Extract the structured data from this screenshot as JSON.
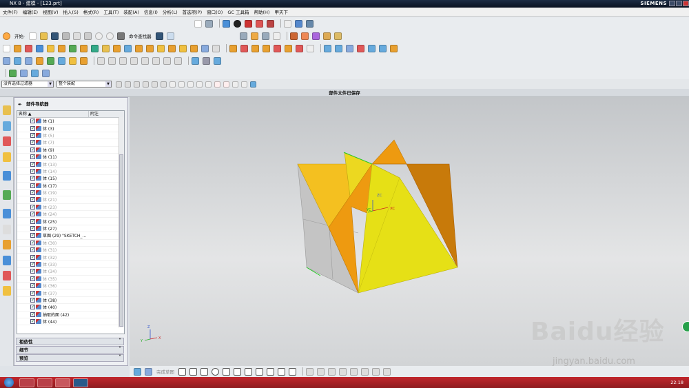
{
  "window": {
    "title": "NX 8 - 建模 - [123.prt]",
    "brand": "SIEMENS"
  },
  "menu": [
    "文件(F)",
    "编辑(E)",
    "视图(V)",
    "插入(S)",
    "格式(R)",
    "工具(T)",
    "装配(A)",
    "信息(I)",
    "分析(L)",
    "首选项(P)",
    "窗口(O)",
    "GC 工具箱",
    "帮助(H)",
    "甲天下"
  ],
  "toolbar": {
    "start_label": "开始·",
    "command_finder_label": "命令查找器"
  },
  "filters": {
    "selection_filter": "没有选择过滤器",
    "assembly_scope": "整个装配"
  },
  "status": {
    "message": "部件文件已保存"
  },
  "navigator": {
    "title": "部件导航器",
    "col_name": "名称",
    "col_note": "附注",
    "rows": [
      {
        "label": "体 (1)",
        "dim": false
      },
      {
        "label": "体 (3)",
        "dim": false
      },
      {
        "label": "体 (5)",
        "dim": true
      },
      {
        "label": "体 (7)",
        "dim": true
      },
      {
        "label": "体 (9)",
        "dim": false
      },
      {
        "label": "体 (11)",
        "dim": false
      },
      {
        "label": "体 (13)",
        "dim": true
      },
      {
        "label": "体 (14)",
        "dim": true
      },
      {
        "label": "体 (15)",
        "dim": false
      },
      {
        "label": "体 (17)",
        "dim": false
      },
      {
        "label": "体 (19)",
        "dim": true
      },
      {
        "label": "体 (21)",
        "dim": true
      },
      {
        "label": "体 (23)",
        "dim": true
      },
      {
        "label": "体 (24)",
        "dim": true
      },
      {
        "label": "体 (25)",
        "dim": false
      },
      {
        "label": "体 (27)",
        "dim": false
      },
      {
        "label": "草图 (29) \"SKETCH_...",
        "dim": false
      },
      {
        "label": "体 (30)",
        "dim": true
      },
      {
        "label": "体 (31)",
        "dim": true
      },
      {
        "label": "体 (32)",
        "dim": true
      },
      {
        "label": "体 (33)",
        "dim": true
      },
      {
        "label": "体 (34)",
        "dim": true
      },
      {
        "label": "体 (35)",
        "dim": true
      },
      {
        "label": "体 (36)",
        "dim": true
      },
      {
        "label": "体 (37)",
        "dim": true
      },
      {
        "label": "体 (38)",
        "dim": false
      },
      {
        "label": "体 (40)",
        "dim": false
      },
      {
        "label": "抽取的面 (42)",
        "dim": false
      },
      {
        "label": "体 (44)",
        "dim": false
      }
    ],
    "sections": [
      "相依性",
      "细节",
      "预览"
    ]
  },
  "viewport": {
    "axes": {
      "z": "ZC",
      "y": "YC",
      "x": "XC"
    },
    "triad": {
      "z": "Z",
      "y": "Y",
      "x": "X"
    }
  },
  "bottom_toolbar": {
    "sketch_label": "完成草图"
  },
  "taskbar": {
    "clock": "22:18"
  },
  "watermark": {
    "brand": "Baidu经验",
    "url": "jingyan.baidu.com"
  },
  "colors": {
    "yellow": "#e6e016",
    "orange": "#ee9a10",
    "dark_orange": "#c87a0a",
    "gold": "#f4c020",
    "gray": "#c4c4c4",
    "taskbar": "#b52227"
  }
}
